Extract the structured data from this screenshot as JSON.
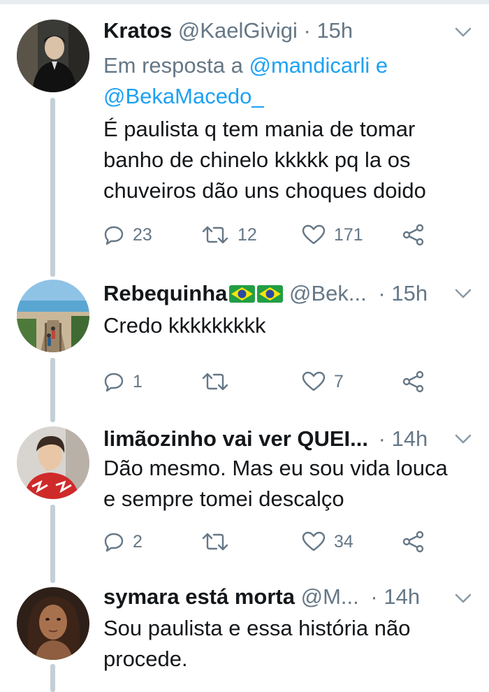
{
  "tweets": [
    {
      "name": "Kratos",
      "handle": "@KaelGivigi",
      "sep": "·",
      "time": "15h",
      "reply_prefix": "Em resposta a",
      "reply_mention_1": "@mandicarli",
      "reply_conj": "e",
      "reply_mention_2": "@BekaMacedo_",
      "text": "É paulista q tem mania de tomar banho de chinelo kkkkk pq la os chuveiros dão uns choques doido",
      "replies": "23",
      "retweets": "12",
      "likes": "171"
    },
    {
      "name": "Rebequinha",
      "handle": "@Bek...",
      "sep": "·",
      "time": "15h",
      "text": "Credo kkkkkkkkk",
      "replies": "1",
      "retweets": "",
      "likes": "7"
    },
    {
      "name": "limãozinho vai ver QUEI...",
      "handle": "",
      "sep": "·",
      "time": "14h",
      "text": "Dão mesmo. Mas eu sou vida louca e sempre tomei descalço",
      "replies": "2",
      "retweets": "",
      "likes": "34"
    },
    {
      "name": "symara está morta",
      "handle": "@M...",
      "sep": "·",
      "time": "14h",
      "text": "Sou paulista e essa história não procede."
    }
  ],
  "icons": {
    "reply": "reply-icon",
    "retweet": "retweet-icon",
    "like": "heart-icon",
    "share": "share-icon",
    "menu": "chevron-down-icon",
    "flag": "brazil-flag-emoji"
  },
  "colors": {
    "text": "#14171a",
    "secondary": "#657786",
    "link": "#1da1f2",
    "thread_line": "#c4cfd6"
  }
}
